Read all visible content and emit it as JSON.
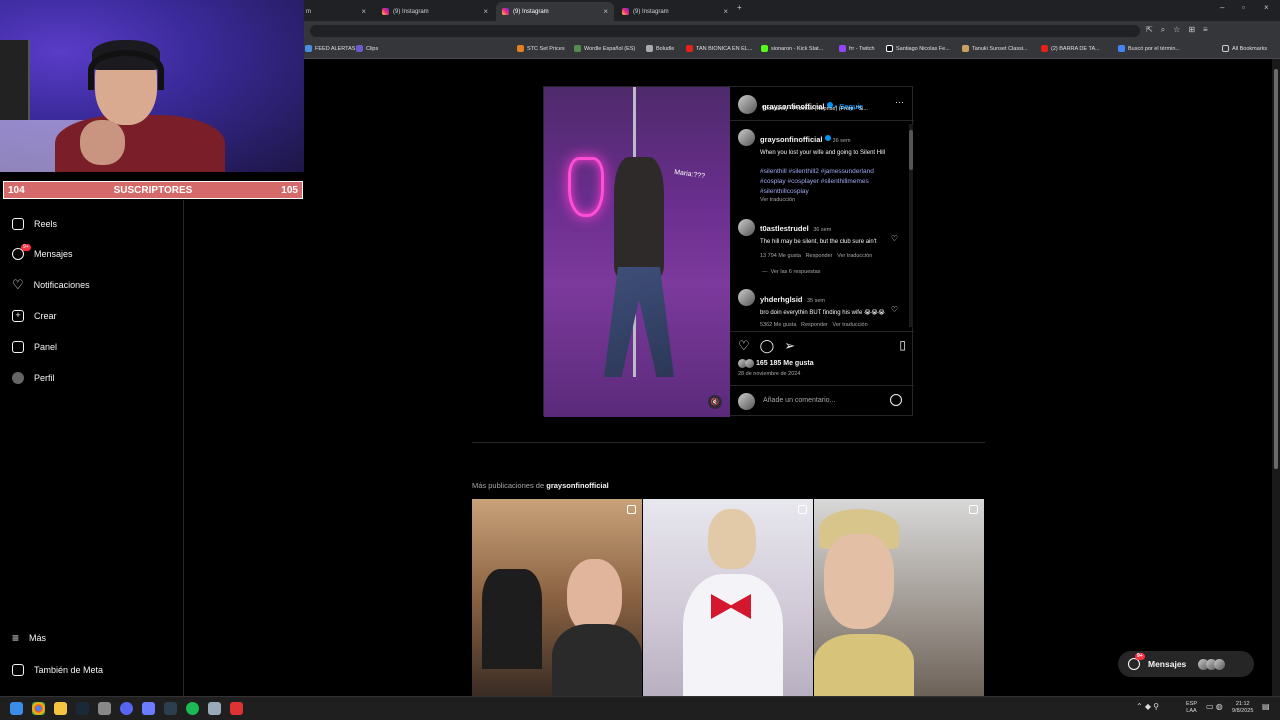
{
  "browser": {
    "tabs": [
      {
        "label": "m",
        "active": false
      },
      {
        "label": "(9) Instagram",
        "active": false
      },
      {
        "label": "(9) Instagram",
        "active": true
      },
      {
        "label": "(9) Instagram",
        "active": false
      }
    ],
    "bookmarks": [
      "FEED ALERTAS",
      "Clips",
      "STC Set Prices",
      "Wordle Español (ES)",
      "Boludle",
      "TAN BIONICA EN EL...",
      "sionaron - Kick Stat...",
      "frr - Twitch",
      "Santiago Nicolas Fe...",
      "Tanuki Sunset Classi...",
      "(2) BARRA DE TA...",
      "Buscó por el términ...",
      "All Bookmarks"
    ]
  },
  "stream": {
    "sub_left": "104",
    "sub_label": "SUSCRIPTORES",
    "sub_right": "105"
  },
  "nav": {
    "items": [
      {
        "label": "Reels",
        "icon": "reels-icon"
      },
      {
        "label": "Mensajes",
        "icon": "messenger-icon",
        "badge": "9+"
      },
      {
        "label": "Notificaciones",
        "icon": "heart-icon"
      },
      {
        "label": "Crear",
        "icon": "plus-icon"
      },
      {
        "label": "Panel",
        "icon": "chart-icon"
      },
      {
        "label": "Perfil",
        "icon": "avatar-icon"
      }
    ],
    "more": "Más",
    "meta": "También de Meta"
  },
  "post": {
    "author": "graysonfinofficial",
    "follow": "• Seguir",
    "audio": "Thomandy • Promise (Reprise) (From: \"Si...",
    "media_caption": "Maria:???",
    "caption": {
      "author": "graysonfinofficial",
      "age": "36 sem",
      "text": "When you lost your wife and going to Silent Hill",
      "hashtags": "#silenthill #silenthill2 #jamessunderland #cosplay #cosplayer #silenthillmemes #silenthillcosplay",
      "translate": "Ver traducción"
    },
    "comments": [
      {
        "author": "t0astlestrudel",
        "age": "36 sem",
        "text": "The hill may be silent, but the club sure ain't",
        "likes": "13 794 Me gusta",
        "reply": "Responder",
        "translate": "Ver traducción",
        "replies": "Ver las 6 respuestas"
      },
      {
        "author": "yhderhglsid",
        "age": "35 sem",
        "text": "bro doin everythin BUT finding his wife 😭😭😭",
        "likes": "5362 Me gusta",
        "reply": "Responder",
        "translate": "Ver traducción"
      }
    ],
    "likes": "165 185 Me gusta",
    "date": "28 de noviembre de 2024",
    "add_comment": "Añade un comentario..."
  },
  "more_posts": {
    "prefix": "Más publicaciones de",
    "author": "graysonfinofficial"
  },
  "messages_pill": {
    "label": "Mensajes",
    "badge": "9+"
  },
  "taskbar": {
    "lang": "ESP",
    "lang2": "LAA",
    "time": "21:12",
    "date": "9/8/2025"
  },
  "colors": {
    "accent": "#0095f6",
    "badge": "#ff3040",
    "subbar": "#d46a6a"
  }
}
